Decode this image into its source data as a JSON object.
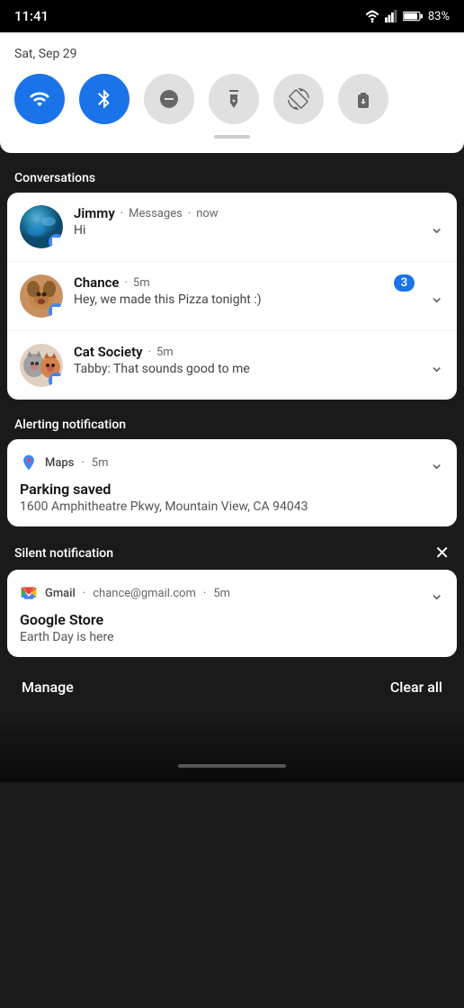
{
  "statusBar": {
    "time": "11:41",
    "battery": "83%",
    "batteryLevel": 83
  },
  "quickSettings": {
    "date": "Sat, Sep 29",
    "buttons": [
      {
        "id": "wifi",
        "label": "Wi-Fi",
        "active": true
      },
      {
        "id": "bluetooth",
        "label": "Bluetooth",
        "active": true
      },
      {
        "id": "dnd",
        "label": "Do Not Disturb",
        "active": false
      },
      {
        "id": "flashlight",
        "label": "Flashlight",
        "active": false
      },
      {
        "id": "autorotate",
        "label": "Auto-rotate",
        "active": false
      },
      {
        "id": "battery",
        "label": "Battery Saver",
        "active": false
      }
    ]
  },
  "sections": {
    "conversations": {
      "label": "Conversations",
      "notifications": [
        {
          "id": "jimmy",
          "sender": "Jimmy",
          "app": "Messages",
          "time": "now",
          "body": "Hi",
          "unreadCount": null
        },
        {
          "id": "chance",
          "sender": "Chance",
          "app": null,
          "time": "5m",
          "body": "Hey, we made this Pizza tonight :)",
          "unreadCount": 3
        },
        {
          "id": "cat-society",
          "sender": "Cat Society",
          "app": null,
          "time": "5m",
          "body": "Tabby: That sounds good to me",
          "unreadCount": null
        }
      ]
    },
    "alerting": {
      "label": "Alerting notification",
      "maps": {
        "appName": "Maps",
        "time": "5m",
        "title": "Parking saved",
        "address": "1600 Amphitheatre Pkwy, Mountain View, CA 94043"
      }
    },
    "silent": {
      "label": "Silent notification",
      "gmail": {
        "appName": "Gmail",
        "sender": "chance@gmail.com",
        "time": "5m",
        "title": "Google Store",
        "body": "Earth Day is here"
      }
    }
  },
  "footer": {
    "manage": "Manage",
    "clearAll": "Clear all"
  }
}
